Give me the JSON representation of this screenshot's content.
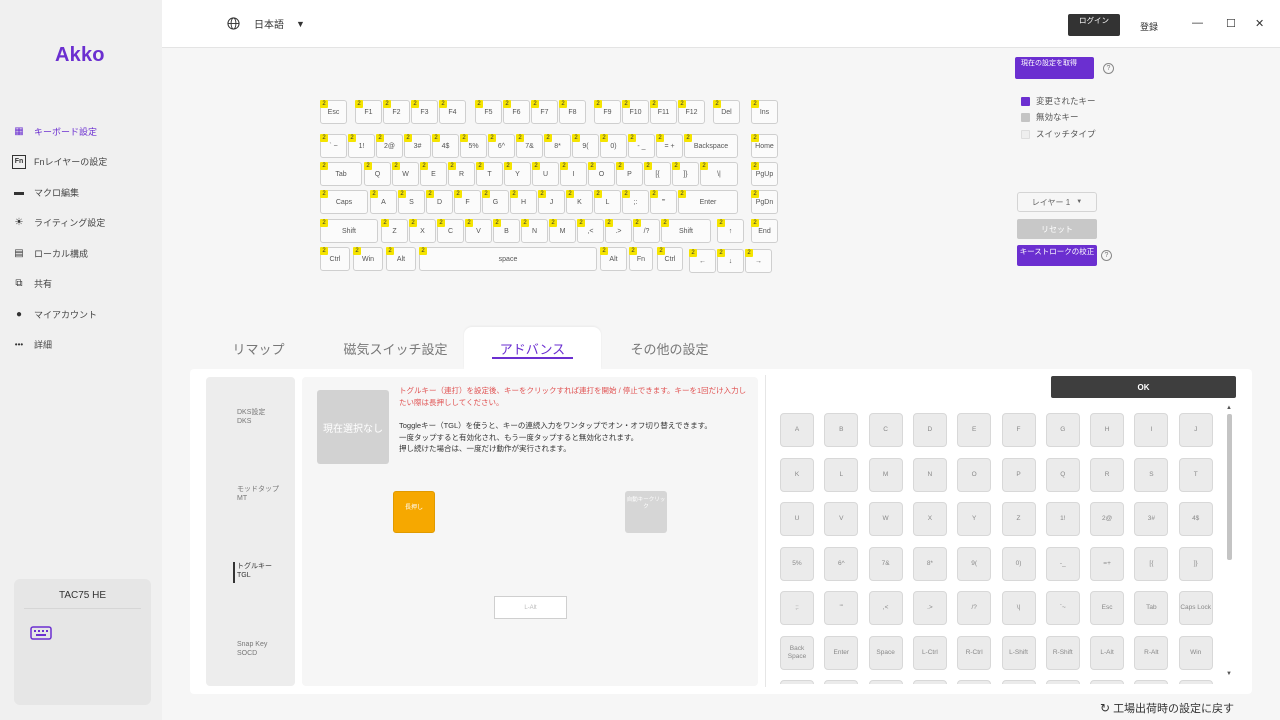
{
  "app": {
    "logo": "Akko",
    "language": "日本語",
    "login_label": "ログイン",
    "register_label": "登録"
  },
  "window_controls": {
    "minimize": "—",
    "maximize": "☐",
    "close": "✕"
  },
  "sidebar": {
    "items": [
      {
        "label": "キーボード設定",
        "icon": "keyboard-icon",
        "active": true
      },
      {
        "label": "Fnレイヤーの設定",
        "icon": "fn-icon",
        "active": false
      },
      {
        "label": "マクロ編集",
        "icon": "macro-icon",
        "active": false
      },
      {
        "label": "ライティング設定",
        "icon": "lighting-icon",
        "active": false
      },
      {
        "label": "ローカル構成",
        "icon": "local-config-icon",
        "active": false
      },
      {
        "label": "共有",
        "icon": "share-icon",
        "active": false
      },
      {
        "label": "マイアカウント",
        "icon": "user-icon",
        "active": false
      },
      {
        "label": "詳細",
        "icon": "more-icon",
        "active": false
      }
    ],
    "device_name": "TAC75 HE"
  },
  "keyboard": {
    "badge": "2",
    "rows": [
      [
        [
          "Esc",
          0,
          27
        ],
        [
          "F1",
          35,
          27
        ],
        [
          "F2",
          63,
          27
        ],
        [
          "F3",
          91,
          27
        ],
        [
          "F4",
          119,
          27
        ],
        [
          "F5",
          155,
          27
        ],
        [
          "F6",
          183,
          27
        ],
        [
          "F7",
          211,
          27
        ],
        [
          "F8",
          239,
          27
        ],
        [
          "F9",
          274,
          27
        ],
        [
          "F10",
          302,
          27
        ],
        [
          "F11",
          330,
          27
        ],
        [
          "F12",
          358,
          27
        ],
        [
          "Del",
          393,
          27
        ],
        [
          "Ins",
          431,
          27
        ]
      ],
      [
        [
          "` ~",
          0,
          27
        ],
        [
          "1!",
          28,
          27
        ],
        [
          "2@",
          56,
          27
        ],
        [
          "3#",
          84,
          27
        ],
        [
          "4$",
          112,
          27
        ],
        [
          "5%",
          140,
          27
        ],
        [
          "6^",
          168,
          27
        ],
        [
          "7&",
          196,
          27
        ],
        [
          "8*",
          224,
          27
        ],
        [
          "9(",
          252,
          27
        ],
        [
          "0)",
          280,
          27
        ],
        [
          "- _",
          308,
          27
        ],
        [
          "= +",
          336,
          27
        ],
        [
          "Backspace",
          364,
          54
        ],
        [
          "Home",
          431,
          27
        ]
      ],
      [
        [
          "Tab",
          0,
          42
        ],
        [
          "Q",
          44,
          27
        ],
        [
          "W",
          72,
          27
        ],
        [
          "E",
          100,
          27
        ],
        [
          "R",
          128,
          27
        ],
        [
          "T",
          156,
          27
        ],
        [
          "Y",
          184,
          27
        ],
        [
          "U",
          212,
          27
        ],
        [
          "I",
          240,
          27
        ],
        [
          "O",
          268,
          27
        ],
        [
          "P",
          296,
          27
        ],
        [
          "[{",
          324,
          27
        ],
        [
          "]}",
          352,
          27
        ],
        [
          "\\|",
          380,
          38
        ],
        [
          "PgUp",
          431,
          27
        ]
      ],
      [
        [
          "Caps",
          0,
          48
        ],
        [
          "A",
          50,
          27
        ],
        [
          "S",
          78,
          27
        ],
        [
          "D",
          106,
          27
        ],
        [
          "F",
          134,
          27
        ],
        [
          "G",
          162,
          27
        ],
        [
          "H",
          190,
          27
        ],
        [
          "J",
          218,
          27
        ],
        [
          "K",
          246,
          27
        ],
        [
          "L",
          274,
          27
        ],
        [
          ";:",
          302,
          27
        ],
        [
          "'\"",
          330,
          27
        ],
        [
          "Enter",
          358,
          60
        ],
        [
          "PgDn",
          431,
          27
        ]
      ],
      [
        [
          "Shift",
          0,
          58
        ],
        [
          "Z",
          61,
          27
        ],
        [
          "X",
          89,
          27
        ],
        [
          "C",
          117,
          27
        ],
        [
          "V",
          145,
          27
        ],
        [
          "B",
          173,
          27
        ],
        [
          "N",
          201,
          27
        ],
        [
          "M",
          229,
          27
        ],
        [
          ",<",
          257,
          27
        ],
        [
          ".>",
          285,
          27
        ],
        [
          "/?",
          313,
          27
        ],
        [
          "Shift",
          341,
          50
        ],
        [
          "↑",
          397,
          27
        ],
        [
          "End",
          431,
          27
        ]
      ],
      [
        [
          "Ctrl",
          0,
          30
        ],
        [
          "Win",
          33,
          30
        ],
        [
          "Alt",
          66,
          30
        ],
        [
          "space",
          99,
          178
        ],
        [
          "Alt",
          280,
          27
        ],
        [
          "Fn",
          309,
          24
        ],
        [
          "Ctrl",
          337,
          26
        ],
        [
          "←",
          369,
          27
        ],
        [
          "↓",
          397,
          27
        ],
        [
          "→",
          425,
          27
        ]
      ]
    ]
  },
  "legend": {
    "current_settings_button": "現在の設定を取得",
    "changed_keys": "変更されたキー",
    "disabled_keys": "無効なキー",
    "switch_type": "スイッチタイプ",
    "layer_select": "レイヤー 1",
    "reset_button": "リセット",
    "keystroke_button": "キーストロークの校正",
    "colors": {
      "changed": "#6b2fd0",
      "disabled": "#c4c4c4",
      "switch": "#eeeeee"
    }
  },
  "tabs": [
    {
      "label": "リマップ",
      "active": false
    },
    {
      "label": "磁気スイッチ設定",
      "active": false
    },
    {
      "label": "アドバンス",
      "active": true
    },
    {
      "label": "その他の設定",
      "active": false
    }
  ],
  "modes": [
    {
      "label": "DKS設定",
      "sub": "DKS"
    },
    {
      "label": "モッドタップ",
      "sub": "MT"
    },
    {
      "label": "トグルキー",
      "sub": "TGL"
    },
    {
      "label": "Snap Key",
      "sub": "SOCD"
    }
  ],
  "detail": {
    "none_selected": "現在選択なし",
    "warning": "トグルキー（連打）を設定後、キーをクリックすれば連打を開始 / 停止できます。キーを1回だけ入力したい際は長押ししてください。",
    "desc_lines": [
      "Toggleキー（TGL）を使うと、キーの連続入力をワンタップでオン・オフ切り替えできます。",
      "一度タップすると有効化され、もう一度タップすると無効化されます。",
      "押し続けた場合は、一度だけ動作が実行されます。"
    ],
    "orange_key_label": "長押し",
    "gray_key_label": "自動キークリック",
    "alt_slot": "L-Alt"
  },
  "ok_button": "OK",
  "key_grid": [
    [
      "A",
      "B",
      "C",
      "D",
      "E",
      "F",
      "G",
      "H",
      "I",
      "J"
    ],
    [
      "K",
      "L",
      "M",
      "N",
      "O",
      "P",
      "Q",
      "R",
      "S",
      "T"
    ],
    [
      "U",
      "V",
      "W",
      "X",
      "Y",
      "Z",
      "1!",
      "2@",
      "3#",
      "4$"
    ],
    [
      "5%",
      "6^",
      "7&",
      "8*",
      "9(",
      "0)",
      "-_",
      "=+",
      "[{",
      "]}"
    ],
    [
      ";:",
      "'\"",
      ",<",
      ".>",
      "/?",
      "\\|",
      "`~",
      "Esc",
      "Tab",
      "Caps Lock"
    ],
    [
      "Back Space",
      "Enter",
      "Space",
      "L-Ctrl",
      "R-Ctrl",
      "L-Shift",
      "R-Shift",
      "L-Alt",
      "R-Alt",
      "Win"
    ]
  ],
  "factory_reset": "工場出荷時の設定に戻す"
}
